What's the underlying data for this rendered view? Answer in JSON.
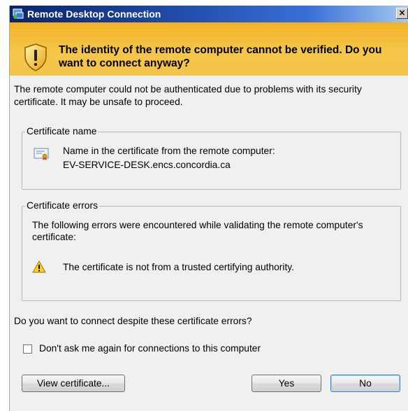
{
  "window": {
    "title": "Remote Desktop Connection",
    "close_glyph": "×"
  },
  "banner": {
    "icon": "warning-shield-icon",
    "heading": "The identity of the remote computer cannot be verified. Do you want to connect anyway?"
  },
  "intro_text": "The remote computer could not be authenticated due to problems with its security certificate. It may be unsafe to proceed.",
  "certificate_name": {
    "group_title": "Certificate name",
    "icon": "certificate-icon",
    "label": "Name in the certificate from the remote computer:",
    "value": "EV-SERVICE-DESK.encs.concordia.ca"
  },
  "certificate_errors": {
    "group_title": "Certificate errors",
    "intro": "The following errors were encountered while validating the remote computer's certificate:",
    "items": [
      {
        "icon": "warning-icon",
        "text": "The certificate is not from a trusted certifying authority."
      }
    ]
  },
  "question": "Do you want to connect despite these certificate errors?",
  "dont_ask": {
    "label": "Don't ask me again for connections to this computer",
    "checked": false
  },
  "buttons": {
    "view_certificate": "View certificate...",
    "yes": "Yes",
    "no": "No"
  },
  "colors": {
    "banner": "#f4c64a",
    "titlebar": "#1f4aa6",
    "dialog_bg": "#f0f0f0"
  }
}
